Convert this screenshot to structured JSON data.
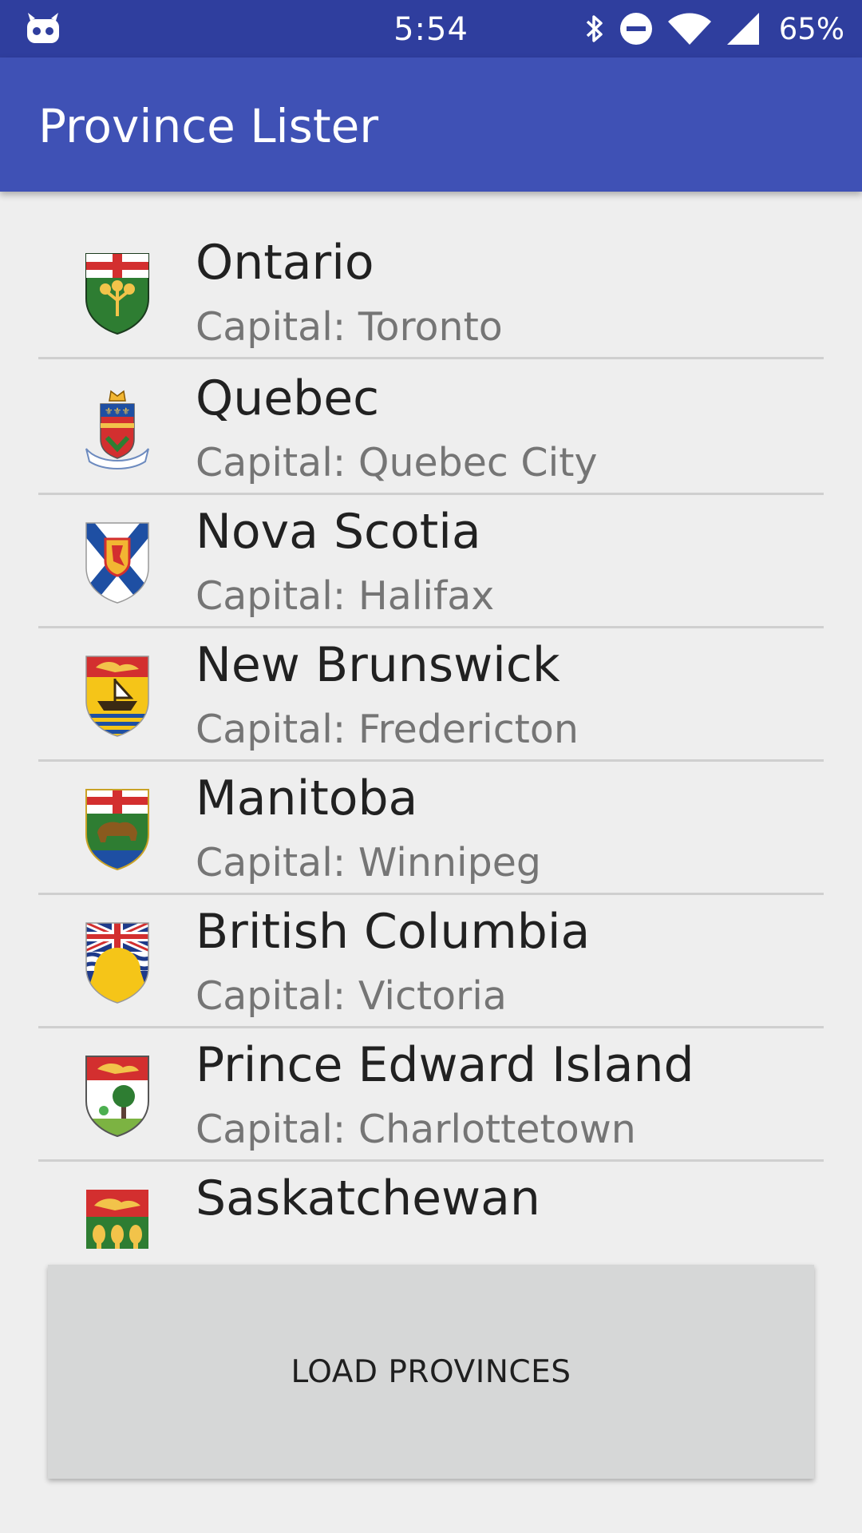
{
  "status_bar": {
    "time": "5:54",
    "battery": "65%",
    "icons": [
      "android-icon",
      "bluetooth-icon",
      "do-not-disturb-icon",
      "wifi-icon",
      "cell-signal-icon"
    ]
  },
  "app_bar": {
    "title": "Province Lister",
    "color": "#3f51b5",
    "status_color": "#2f3e9e"
  },
  "provinces": [
    {
      "name": "Ontario",
      "capital": "Capital: Toronto",
      "crest_icon": "ontario-crest-icon"
    },
    {
      "name": "Quebec",
      "capital": "Capital: Quebec City",
      "crest_icon": "quebec-crest-icon"
    },
    {
      "name": "Nova Scotia",
      "capital": "Capital: Halifax",
      "crest_icon": "nova-scotia-crest-icon"
    },
    {
      "name": "New Brunswick",
      "capital": "Capital: Fredericton",
      "crest_icon": "new-brunswick-crest-icon"
    },
    {
      "name": "Manitoba",
      "capital": "Capital: Winnipeg",
      "crest_icon": "manitoba-crest-icon"
    },
    {
      "name": "British Columbia",
      "capital": "Capital: Victoria",
      "crest_icon": "british-columbia-crest-icon"
    },
    {
      "name": "Prince Edward Island",
      "capital": "Capital: Charlottetown",
      "crest_icon": "pei-crest-icon"
    },
    {
      "name": "Saskatchewan",
      "capital": "",
      "crest_icon": "saskatchewan-crest-icon"
    }
  ],
  "load_button": {
    "label": "LOAD PROVINCES"
  }
}
